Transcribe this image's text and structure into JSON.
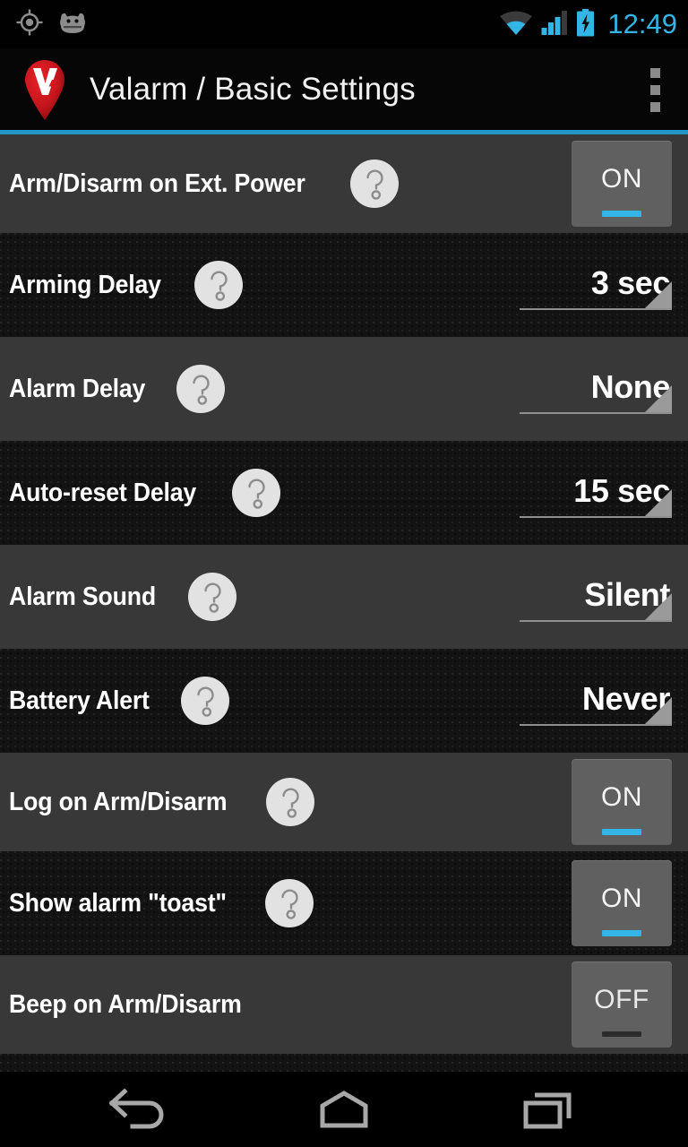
{
  "status_bar": {
    "time": "12:49",
    "icons": [
      "gps-icon",
      "android-face-icon",
      "wifi-icon",
      "signal-icon",
      "battery-charging-icon"
    ],
    "accent_color": "#33b5e5"
  },
  "action_bar": {
    "title": "Valarm / Basic Settings",
    "logo": "valarm-pin-logo",
    "overflow": "overflow-menu-icon",
    "divider_color": "#2196c4"
  },
  "settings": {
    "rows": [
      {
        "label": "Arm/Disarm on Ext. Power",
        "help": true,
        "control": "toggle",
        "value": "ON",
        "shade": "light"
      },
      {
        "label": "Arming Delay",
        "help": true,
        "control": "spinner",
        "value": "3 sec",
        "shade": "dark"
      },
      {
        "label": "Alarm Delay",
        "help": true,
        "control": "spinner",
        "value": "None",
        "shade": "light"
      },
      {
        "label": "Auto-reset Delay",
        "help": true,
        "control": "spinner",
        "value": "15 sec",
        "shade": "dark"
      },
      {
        "label": "Alarm Sound",
        "help": true,
        "control": "spinner",
        "value": "Silent",
        "shade": "light"
      },
      {
        "label": "Battery Alert",
        "help": true,
        "control": "spinner",
        "value": "Never",
        "shade": "dark"
      },
      {
        "label": "Log on Arm/Disarm",
        "help": true,
        "control": "toggle",
        "value": "ON",
        "shade": "light"
      },
      {
        "label": "Show alarm \"toast\"",
        "help": true,
        "control": "toggle",
        "value": "ON",
        "shade": "dark"
      },
      {
        "label": "Beep on Arm/Disarm",
        "help": false,
        "control": "toggle",
        "value": "OFF",
        "shade": "light"
      }
    ],
    "help_glyph": "?",
    "toggle_on_color": "#33b5e5",
    "toggle_off_color": "#2b2b2b"
  },
  "nav_bar": {
    "buttons": [
      {
        "name": "back-icon"
      },
      {
        "name": "home-icon"
      },
      {
        "name": "recents-icon"
      }
    ]
  }
}
